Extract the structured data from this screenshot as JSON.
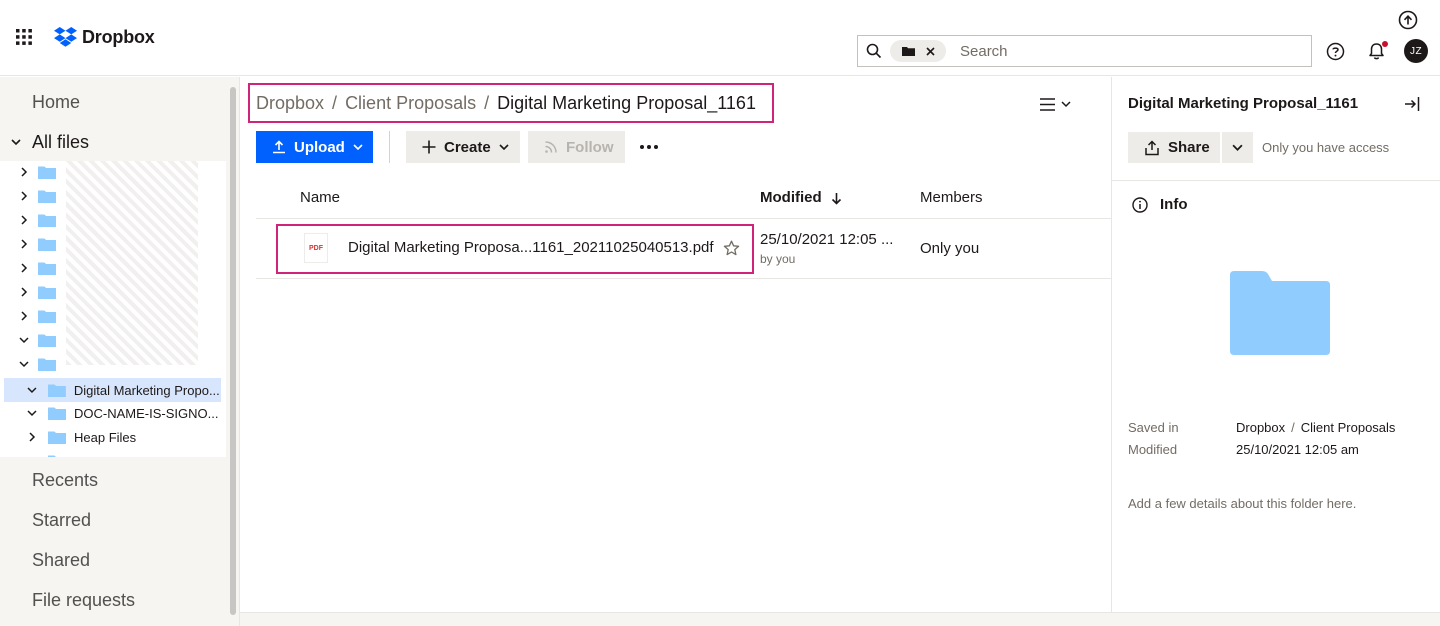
{
  "header": {
    "logo_text": "Dropbox",
    "search_placeholder": "Search",
    "avatar_initials": "JZ"
  },
  "sidebar": {
    "home": "Home",
    "all_files": "All files",
    "tree": [
      {
        "label": "Digital Marketing Propo...",
        "expanded": true,
        "selected": true
      },
      {
        "label": "DOC-NAME-IS-SIGNO...",
        "expanded": true,
        "selected": false
      },
      {
        "label": "Heap Files",
        "expanded": false,
        "selected": false
      }
    ],
    "recents": "Recents",
    "starred": "Starred",
    "shared": "Shared",
    "file_requests": "File requests"
  },
  "breadcrumb": {
    "root": "Dropbox",
    "parent": "Client Proposals",
    "current": "Digital Marketing Proposal_1161",
    "separator": "/"
  },
  "toolbar": {
    "upload": "Upload",
    "create": "Create",
    "follow": "Follow"
  },
  "table": {
    "col_name": "Name",
    "col_modified": "Modified",
    "col_members": "Members",
    "rows": [
      {
        "icon_text": "PDF",
        "name": "Digital Marketing Proposa...1161_20211025040513.pdf",
        "modified": "25/10/2021 12:05 ...",
        "modified_by": "by you",
        "members": "Only you"
      }
    ]
  },
  "panel": {
    "title": "Digital Marketing Proposal_1161",
    "share": "Share",
    "access": "Only you have access",
    "info": "Info",
    "saved_in_label": "Saved in",
    "saved_in_root": "Dropbox",
    "saved_in_sep": "/",
    "saved_in_folder": "Client Proposals",
    "modified_label": "Modified",
    "modified_value": "25/10/2021 12:05 am",
    "details_placeholder": "Add a few details about this folder here."
  },
  "colors": {
    "accent_blue": "#0061fe",
    "highlight_pink": "#d0247a",
    "folder_blue": "#90cdfe",
    "selected_row": "#d7e6fc"
  }
}
